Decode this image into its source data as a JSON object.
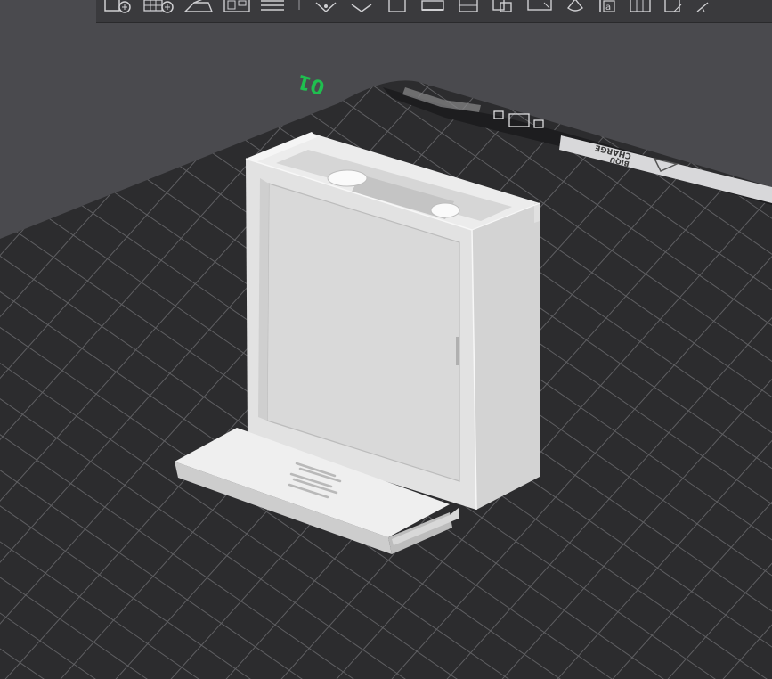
{
  "app": {
    "plate_number": "01",
    "plate_brand_line1": "BIQU",
    "plate_brand_line2": "CHARGE"
  },
  "toolbar": {
    "buttons": [
      {
        "name": "add-object",
        "icon": "add-object-icon"
      },
      {
        "name": "add-plate",
        "icon": "add-plate-icon"
      },
      {
        "name": "auto-orient",
        "icon": "auto-orient-icon"
      },
      {
        "name": "arrange",
        "icon": "arrange-icon"
      },
      {
        "name": "layers",
        "icon": "layers-icon"
      },
      {
        "name": "divider",
        "icon": "divider"
      },
      {
        "name": "move",
        "icon": "move-icon"
      },
      {
        "name": "rotate",
        "icon": "rotate-icon"
      },
      {
        "name": "scale",
        "icon": "scale-icon"
      },
      {
        "name": "lay-on-face",
        "icon": "lay-on-face-icon"
      },
      {
        "name": "cut",
        "icon": "cut-icon"
      },
      {
        "name": "support-paint",
        "icon": "support-paint-icon"
      },
      {
        "name": "seam-paint",
        "icon": "seam-paint-icon"
      },
      {
        "name": "color-paint",
        "icon": "color-paint-icon"
      },
      {
        "name": "text",
        "icon": "text-icon"
      },
      {
        "name": "measure",
        "icon": "measure-icon"
      },
      {
        "name": "assembly",
        "icon": "assembly-icon"
      },
      {
        "name": "mesh-boolean",
        "icon": "mesh-boolean-icon"
      }
    ]
  },
  "colors": {
    "background": "#4a4a4e",
    "plate": "#2c2c2e",
    "grid": "#5f5f62",
    "model": "#e4e4e4",
    "plate_number": "#1fbf4f"
  }
}
